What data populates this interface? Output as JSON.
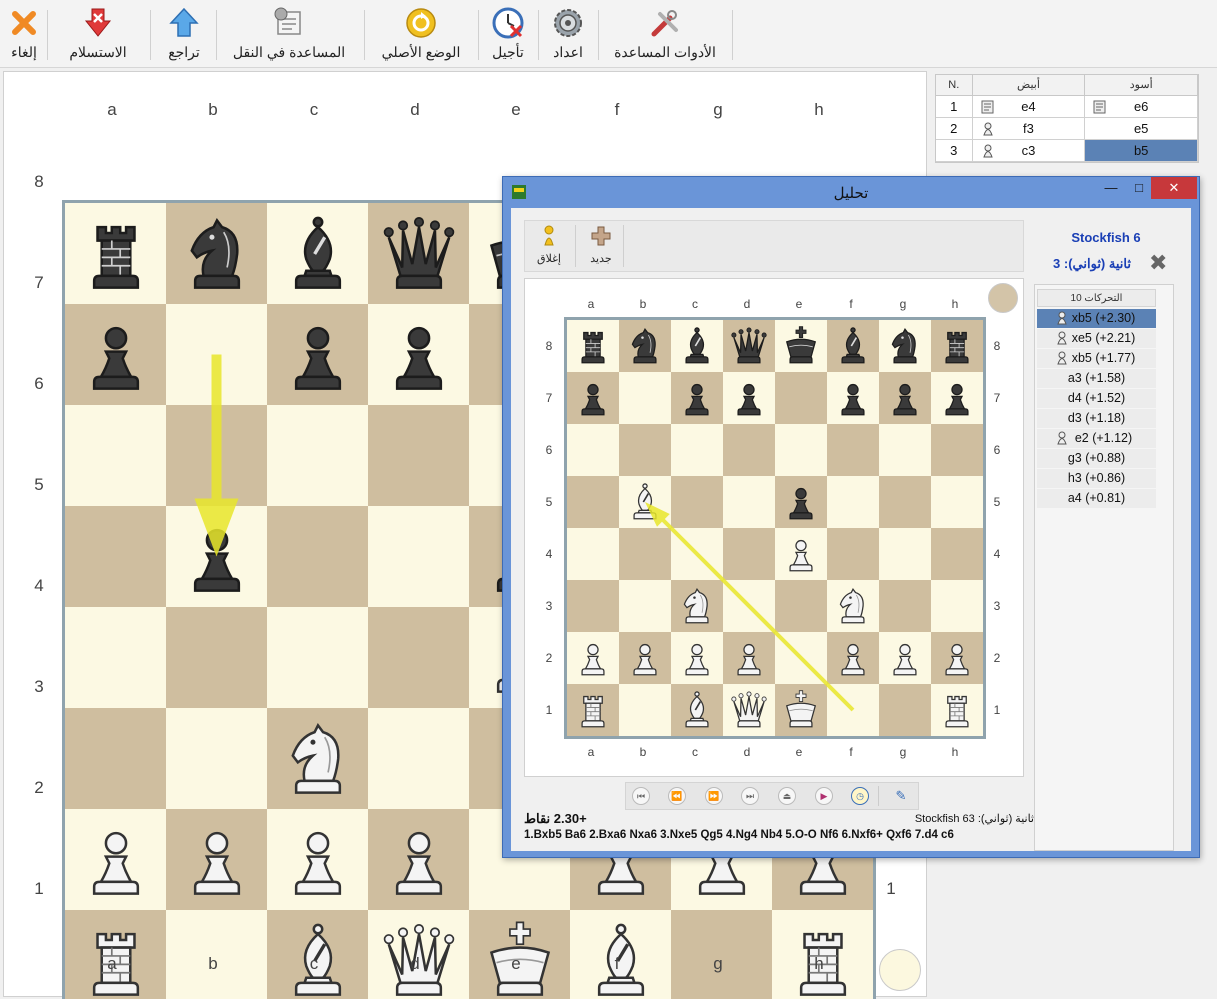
{
  "toolbar": {
    "buttons": [
      {
        "key": "cancel",
        "label": "إلغاء"
      },
      {
        "key": "resign",
        "label": "الاستسلام"
      },
      {
        "key": "undo",
        "label": "تراجع"
      },
      {
        "key": "move_help",
        "label": "المساعدة في النقل"
      },
      {
        "key": "original_position",
        "label": "الوضع الأصلي"
      },
      {
        "key": "postpone",
        "label": "تأجيل"
      },
      {
        "key": "settings",
        "label": "اعداد"
      },
      {
        "key": "help_tools",
        "label": "الأدوات المساعدة"
      }
    ],
    "icons": [
      "close-icon",
      "resign-icon",
      "undo-icon",
      "move-help-icon",
      "reset-position-icon",
      "postpone-clock-icon",
      "settings-gear-icon",
      "help-tools-icon"
    ]
  },
  "main_board": {
    "files": [
      "a",
      "b",
      "c",
      "d",
      "e",
      "f",
      "g",
      "h"
    ],
    "ranks": [
      "8",
      "7",
      "6",
      "5",
      "4",
      "3",
      "2",
      "1"
    ],
    "colors": {
      "light": "#fcf9e3",
      "dark": "#cfbe9f",
      "frame": "#8fa3ad",
      "arrow": "#e8e62a"
    },
    "position": [
      [
        "r",
        "n",
        "b",
        "q",
        "k",
        "b",
        "n",
        "r"
      ],
      [
        "p",
        "",
        "p",
        "p",
        "",
        "p",
        "p",
        "p"
      ],
      [
        "",
        "",
        "",
        "",
        "",
        "",
        "",
        ""
      ],
      [
        "",
        "p",
        "",
        "",
        "p",
        "",
        "",
        ""
      ],
      [
        "",
        "",
        "",
        "",
        "P",
        "",
        "",
        ""
      ],
      [
        "",
        "",
        "N",
        "",
        "",
        "N",
        "",
        ""
      ],
      [
        "P",
        "P",
        "P",
        "P",
        "",
        "P",
        "P",
        "P"
      ],
      [
        "R",
        "",
        "B",
        "Q",
        "K",
        "B",
        "",
        "R"
      ]
    ],
    "arrow": {
      "from": "b7",
      "to": "b5"
    }
  },
  "move_list": {
    "headers": {
      "number": "N.",
      "white": "أبيض",
      "black": "أسود"
    },
    "rows": [
      {
        "n": "1",
        "white": "e4",
        "white_icon": "note-icon",
        "black": "e6",
        "black_icon": "note-icon"
      },
      {
        "n": "2",
        "white": "f3",
        "white_icon": "knight-icon",
        "black": "e5",
        "black_icon": ""
      },
      {
        "n": "3",
        "white": "c3",
        "white_icon": "knight-icon",
        "black": "b5",
        "black_icon": ""
      }
    ],
    "selected": {
      "row": 2,
      "col": "black"
    }
  },
  "analysis": {
    "title": "تحليل",
    "tools": [
      {
        "key": "close",
        "label": "إغلاق"
      },
      {
        "key": "new",
        "label": "جديد"
      }
    ],
    "engine": "Stockfish 6",
    "time": "ثانية (ثواني): 3",
    "moves_header": "التحركات 10",
    "moves": [
      {
        "text": "xb5 (+2.30)",
        "icon": "bishop-icon"
      },
      {
        "text": "xe5 (+2.21)",
        "icon": "knight-icon"
      },
      {
        "text": "xb5 (+1.77)",
        "icon": "knight-icon"
      },
      {
        "text": "a3 (+1.58)",
        "icon": ""
      },
      {
        "text": "d4 (+1.52)",
        "icon": ""
      },
      {
        "text": "d3 (+1.18)",
        "icon": ""
      },
      {
        "text": "e2 (+1.12)",
        "icon": "queen-icon"
      },
      {
        "text": "g3 (+0.88)",
        "icon": ""
      },
      {
        "text": "h3 (+0.86)",
        "icon": ""
      },
      {
        "text": "a4 (+0.81)",
        "icon": ""
      }
    ],
    "selected_move": 0,
    "eval": "+2.30 نقاط",
    "engine_info": "ثانية (ثواني): 63 Stockfish",
    "pv": "1.Bxb5 Ba6 2.Bxa6 Nxa6 3.Nxe5 Qg5 4.Ng4 Nb4 5.O-O Nf6 6.Nxf6+ Qxf6 7.d4 c6",
    "board": {
      "files": [
        "a",
        "b",
        "c",
        "d",
        "e",
        "f",
        "g",
        "h"
      ],
      "ranks": [
        "8",
        "7",
        "6",
        "5",
        "4",
        "3",
        "2",
        "1"
      ],
      "position": [
        [
          "r",
          "n",
          "b",
          "q",
          "k",
          "b",
          "n",
          "r"
        ],
        [
          "p",
          "",
          "p",
          "p",
          "",
          "p",
          "p",
          "p"
        ],
        [
          "",
          "",
          "",
          "",
          "",
          "",
          "",
          ""
        ],
        [
          "",
          "B",
          "",
          "",
          "p",
          "",
          "",
          ""
        ],
        [
          "",
          "",
          "",
          "",
          "P",
          "",
          "",
          ""
        ],
        [
          "",
          "",
          "N",
          "",
          "",
          "N",
          "",
          ""
        ],
        [
          "P",
          "P",
          "P",
          "P",
          "",
          "P",
          "P",
          "P"
        ],
        [
          "R",
          "",
          "B",
          "Q",
          "K",
          "",
          "",
          "R"
        ]
      ],
      "arrow": {
        "from": "f1",
        "to": "b5"
      }
    },
    "nav_icons": [
      "first-icon",
      "prev-icon",
      "next-icon",
      "last-icon",
      "eject-icon",
      "play-icon",
      "clock-icon",
      "edit-icon"
    ]
  }
}
